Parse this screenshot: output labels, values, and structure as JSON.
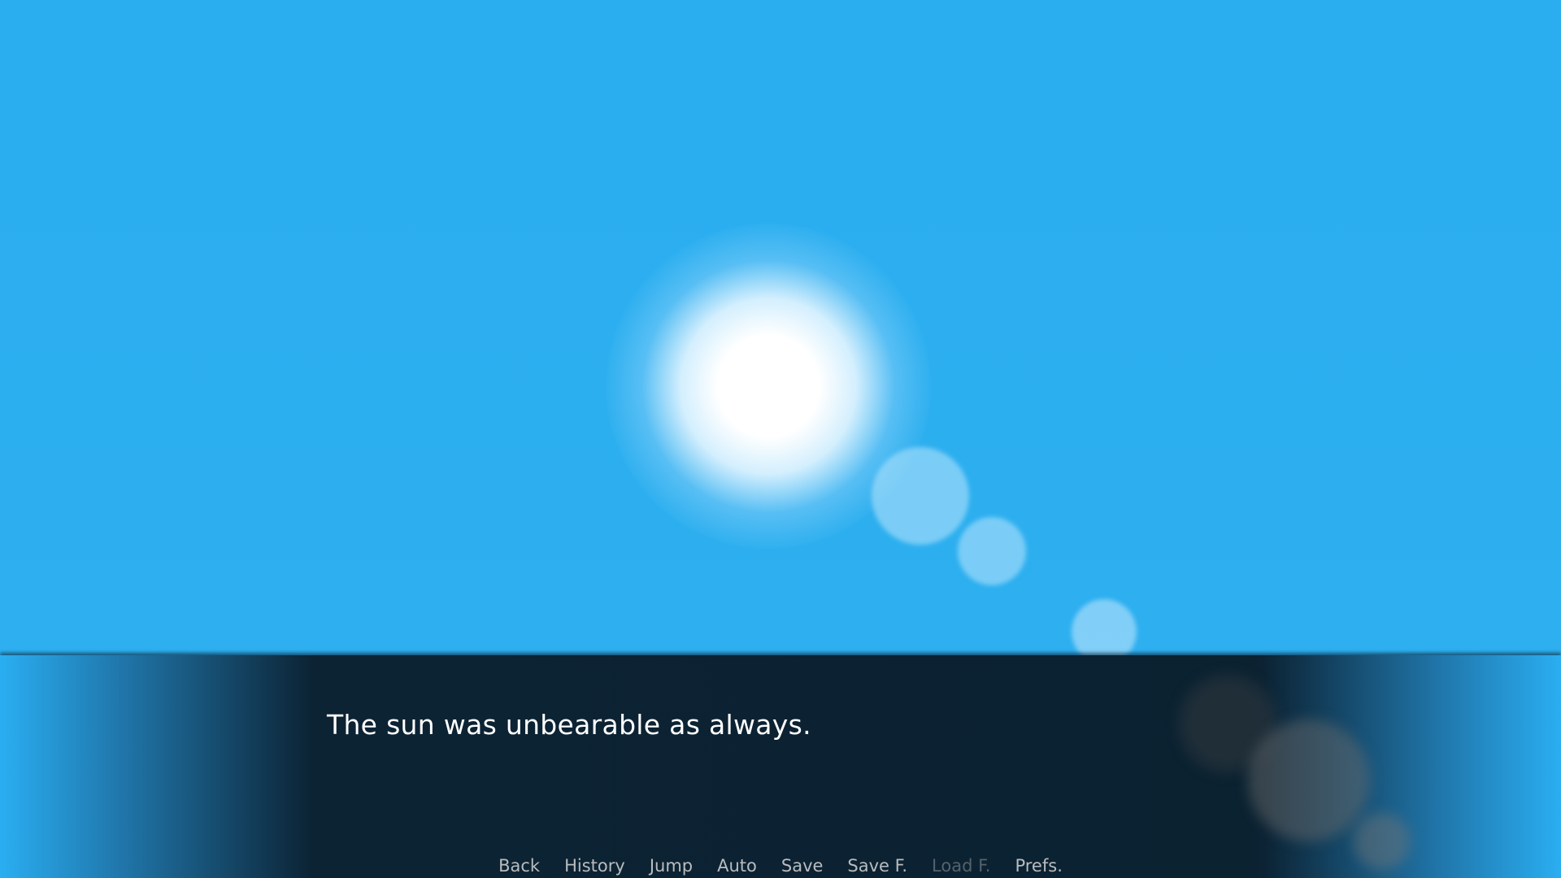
{
  "dialogue": {
    "text": "The sun was unbearable as always."
  },
  "quick_menu": {
    "items": [
      {
        "label": "Back",
        "enabled": true
      },
      {
        "label": "History",
        "enabled": true
      },
      {
        "label": "Jump",
        "enabled": true
      },
      {
        "label": "Auto",
        "enabled": true
      },
      {
        "label": "Save",
        "enabled": true
      },
      {
        "label": "Save F.",
        "enabled": true
      },
      {
        "label": "Load F.",
        "enabled": false
      },
      {
        "label": "Prefs.",
        "enabled": true
      }
    ]
  },
  "colors": {
    "sky": "#2aaef2",
    "textbox": "#0b2231",
    "menu_text": "#b9bcbf",
    "menu_disabled": "#55626b"
  }
}
